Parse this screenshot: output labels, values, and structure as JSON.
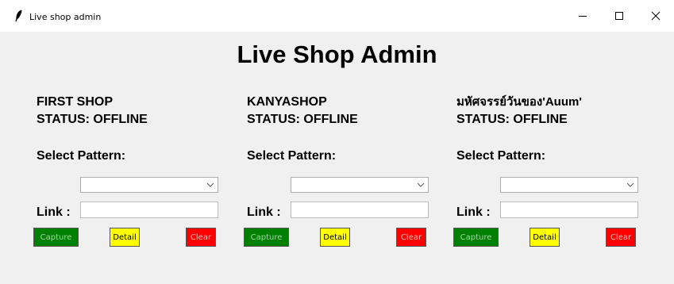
{
  "window": {
    "title": "Live shop admin"
  },
  "heading": "Live Shop Admin",
  "shops": [
    {
      "name": "FIRST SHOP",
      "status": "STATUS: OFFLINE",
      "pattern_label": "Select Pattern:",
      "pattern_value": "",
      "link_label": "Link :",
      "link_value": "",
      "capture_label": "Capture",
      "detail_label": "Detail",
      "clear_label": "Clear"
    },
    {
      "name": "KANYASHOP",
      "status": "STATUS: OFFLINE",
      "pattern_label": "Select Pattern:",
      "pattern_value": "",
      "link_label": "Link :",
      "link_value": "",
      "capture_label": "Capture",
      "detail_label": "Detail",
      "clear_label": "Clear"
    },
    {
      "name": "มหัศจรรย์วันของ'Auum'",
      "status": "STATUS: OFFLINE",
      "pattern_label": "Select Pattern:",
      "pattern_value": "",
      "link_label": "Link :",
      "link_value": "",
      "capture_label": "Capture",
      "detail_label": "Detail",
      "clear_label": "Clear"
    }
  ],
  "colors": {
    "capture": "#008000",
    "detail": "#ffff00",
    "clear": "#ff0000",
    "background": "#f0f0f0"
  }
}
